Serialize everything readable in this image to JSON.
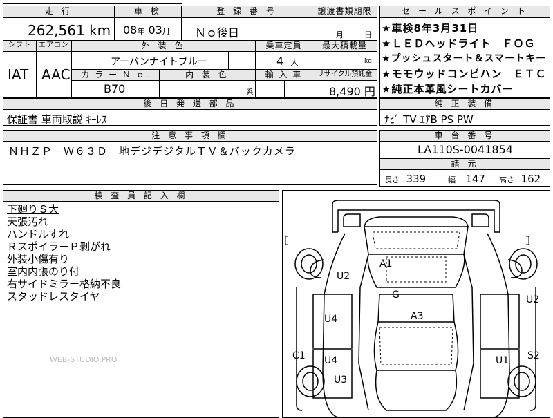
{
  "mileage": {
    "header": "走 行",
    "value": "262,561",
    "unit": "km"
  },
  "inspection": {
    "header": "車 検",
    "year": "08",
    "year_unit": "年",
    "month": "03",
    "month_unit": "月"
  },
  "registration": {
    "header": "登 録 番 号",
    "value": "Ｎｏ後日"
  },
  "transfer_deadline": {
    "header": "譲渡書類期限",
    "month_unit": "月",
    "day_unit": "日"
  },
  "shift": {
    "header": "シフト",
    "value": "IAT"
  },
  "aircon": {
    "header": "エアコン",
    "value": "AAC"
  },
  "exterior_color": {
    "header": "外 装 色",
    "value": "アーバンナイトブルー"
  },
  "color_no": {
    "header": "カ ラ ー Ｎ ｏ.",
    "value": "B70"
  },
  "interior_color": {
    "header": "内 装 色",
    "suffix": "系"
  },
  "capacity": {
    "header": "乗車定員",
    "value": "4",
    "unit": "人"
  },
  "max_load": {
    "header": "最大積載量",
    "unit": "kg"
  },
  "import": {
    "header": "輸 入 車"
  },
  "recycle": {
    "header": "リサイクル預託金",
    "value": "8,490",
    "unit": "円"
  },
  "later_items": {
    "header": "後 日 発 送 部 品",
    "value": "保証書 車両取説 ｷｰﾚｽ"
  },
  "notes": {
    "header": "注 意 事 項 欄",
    "value": "ＮＨＺＰ－Ｗ６３Ｄ　地デジデジタルＴＶ＆バックカメラ"
  },
  "sales_points": {
    "header": "セ ー ル ス ポ イ ン ト",
    "items": [
      "★車検8年3月31日",
      "★ＬＥＤヘッドライト　ＦＯＧ",
      "★プッシュスタート＆スマートキー",
      "★モモウッドコンビハン　ＥＴＣ",
      "★純正本革風シートカバー"
    ]
  },
  "genuine_equipment": {
    "header": "純 正 装 備",
    "value": "ﾅﾋﾞ TV ｴｱB PS PW"
  },
  "chassis": {
    "header": "車 台 番 号",
    "value": "LA110S-0041854"
  },
  "dimensions": {
    "header": "諸 元",
    "length_label": "長さ",
    "length": "339",
    "width_label": "幅",
    "width": "147",
    "height_label": "高さ",
    "height": "162"
  },
  "inspector": {
    "header": "検 査 員 記 入 欄",
    "remarks": [
      "下廻りＳ大",
      "天張汚れ",
      "ハンドルすれ",
      "Ｒスポイラ－Ｐ剥がれ",
      "外装小傷有り",
      "室内内張のり付",
      "右サイドミラー格納不良",
      "スタッドレスタイヤ"
    ]
  },
  "watermark": "WEB-STUDIO.PRO",
  "diagram_marks": {
    "a1": "A1",
    "g": "G",
    "a3": "A3",
    "u2_left": "U2",
    "u2_right": "U2",
    "u4_upper": "U4",
    "u4_lower": "U4",
    "u1": "U1",
    "c1": "C1",
    "s2": "S2",
    "u3": "U3"
  },
  "colors": {
    "header_bg": "#e8e8e8",
    "border": "#000000"
  }
}
